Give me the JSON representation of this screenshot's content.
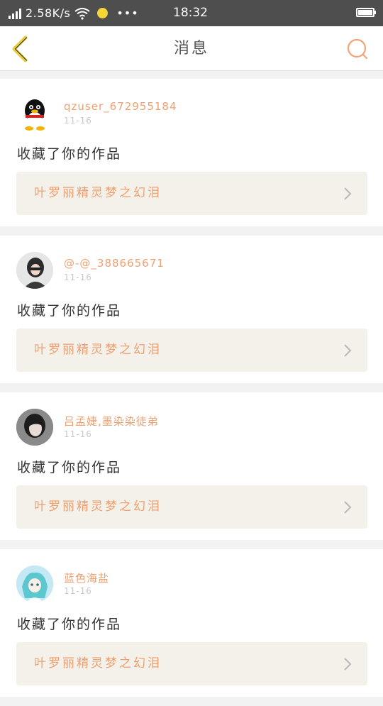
{
  "status_bar": {
    "speed": "2.58K/s",
    "time": "18:32",
    "icons": [
      "signal-icon",
      "wifi-icon",
      "notification-dot-icon",
      "more-dots-icon",
      "battery-icon"
    ]
  },
  "navbar": {
    "title": "消息",
    "back_icon": "chevron-left-icon",
    "search_icon": "search-icon",
    "accent_color": "#e9cd3b",
    "search_color": "#f3a375"
  },
  "notifications": [
    {
      "username": "qzuser_672955184",
      "date": "11-16",
      "action": "收藏了你的作品",
      "work_title": "叶罗丽精灵梦之幻泪",
      "avatar": "qq-penguin-avatar"
    },
    {
      "username": "@-@_388665671",
      "date": "11-16",
      "action": "收藏了你的作品",
      "work_title": "叶罗丽精灵梦之幻泪",
      "avatar": "girl-photo-avatar"
    },
    {
      "username": "吕孟婕,墨染染徒弟",
      "date": "11-16",
      "action": "收藏了你的作品",
      "work_title": "叶罗丽精灵梦之幻泪",
      "avatar": "portrait-photo-avatar"
    },
    {
      "username": "蓝色海盐",
      "date": "11-16",
      "action": "收藏了你的作品",
      "work_title": "叶罗丽精灵梦之幻泪",
      "avatar": "anime-girl-avatar"
    }
  ]
}
